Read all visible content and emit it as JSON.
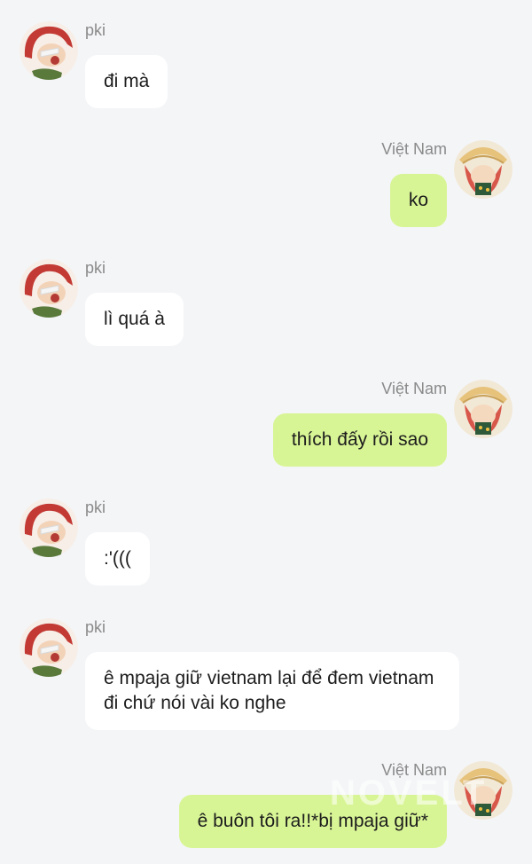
{
  "conversation": {
    "messages": [
      {
        "side": "left",
        "sender": "pki",
        "text": "đi mà"
      },
      {
        "side": "right",
        "sender": "Việt Nam",
        "text": "ko"
      },
      {
        "side": "left",
        "sender": "pki",
        "text": "lì quá à"
      },
      {
        "side": "right",
        "sender": "Việt Nam",
        "text": "thích đấy rồi sao"
      },
      {
        "side": "left",
        "sender": "pki",
        "text": ":'((("
      },
      {
        "side": "left",
        "sender": "pki",
        "text": "ê mpaja giữ vietnam lại để đem vietnam đi chứ nói vài ko nghe"
      },
      {
        "side": "right",
        "sender": "Việt Nam",
        "text": "ê buôn tôi ra!!*bị mpaja giữ*"
      }
    ]
  },
  "watermark": {
    "text": "NOVELT"
  },
  "colors": {
    "background": "#f4f5f7",
    "left_bubble": "#ffffff",
    "right_bubble": "#d8f596",
    "sender_text": "#8a8a8a"
  }
}
